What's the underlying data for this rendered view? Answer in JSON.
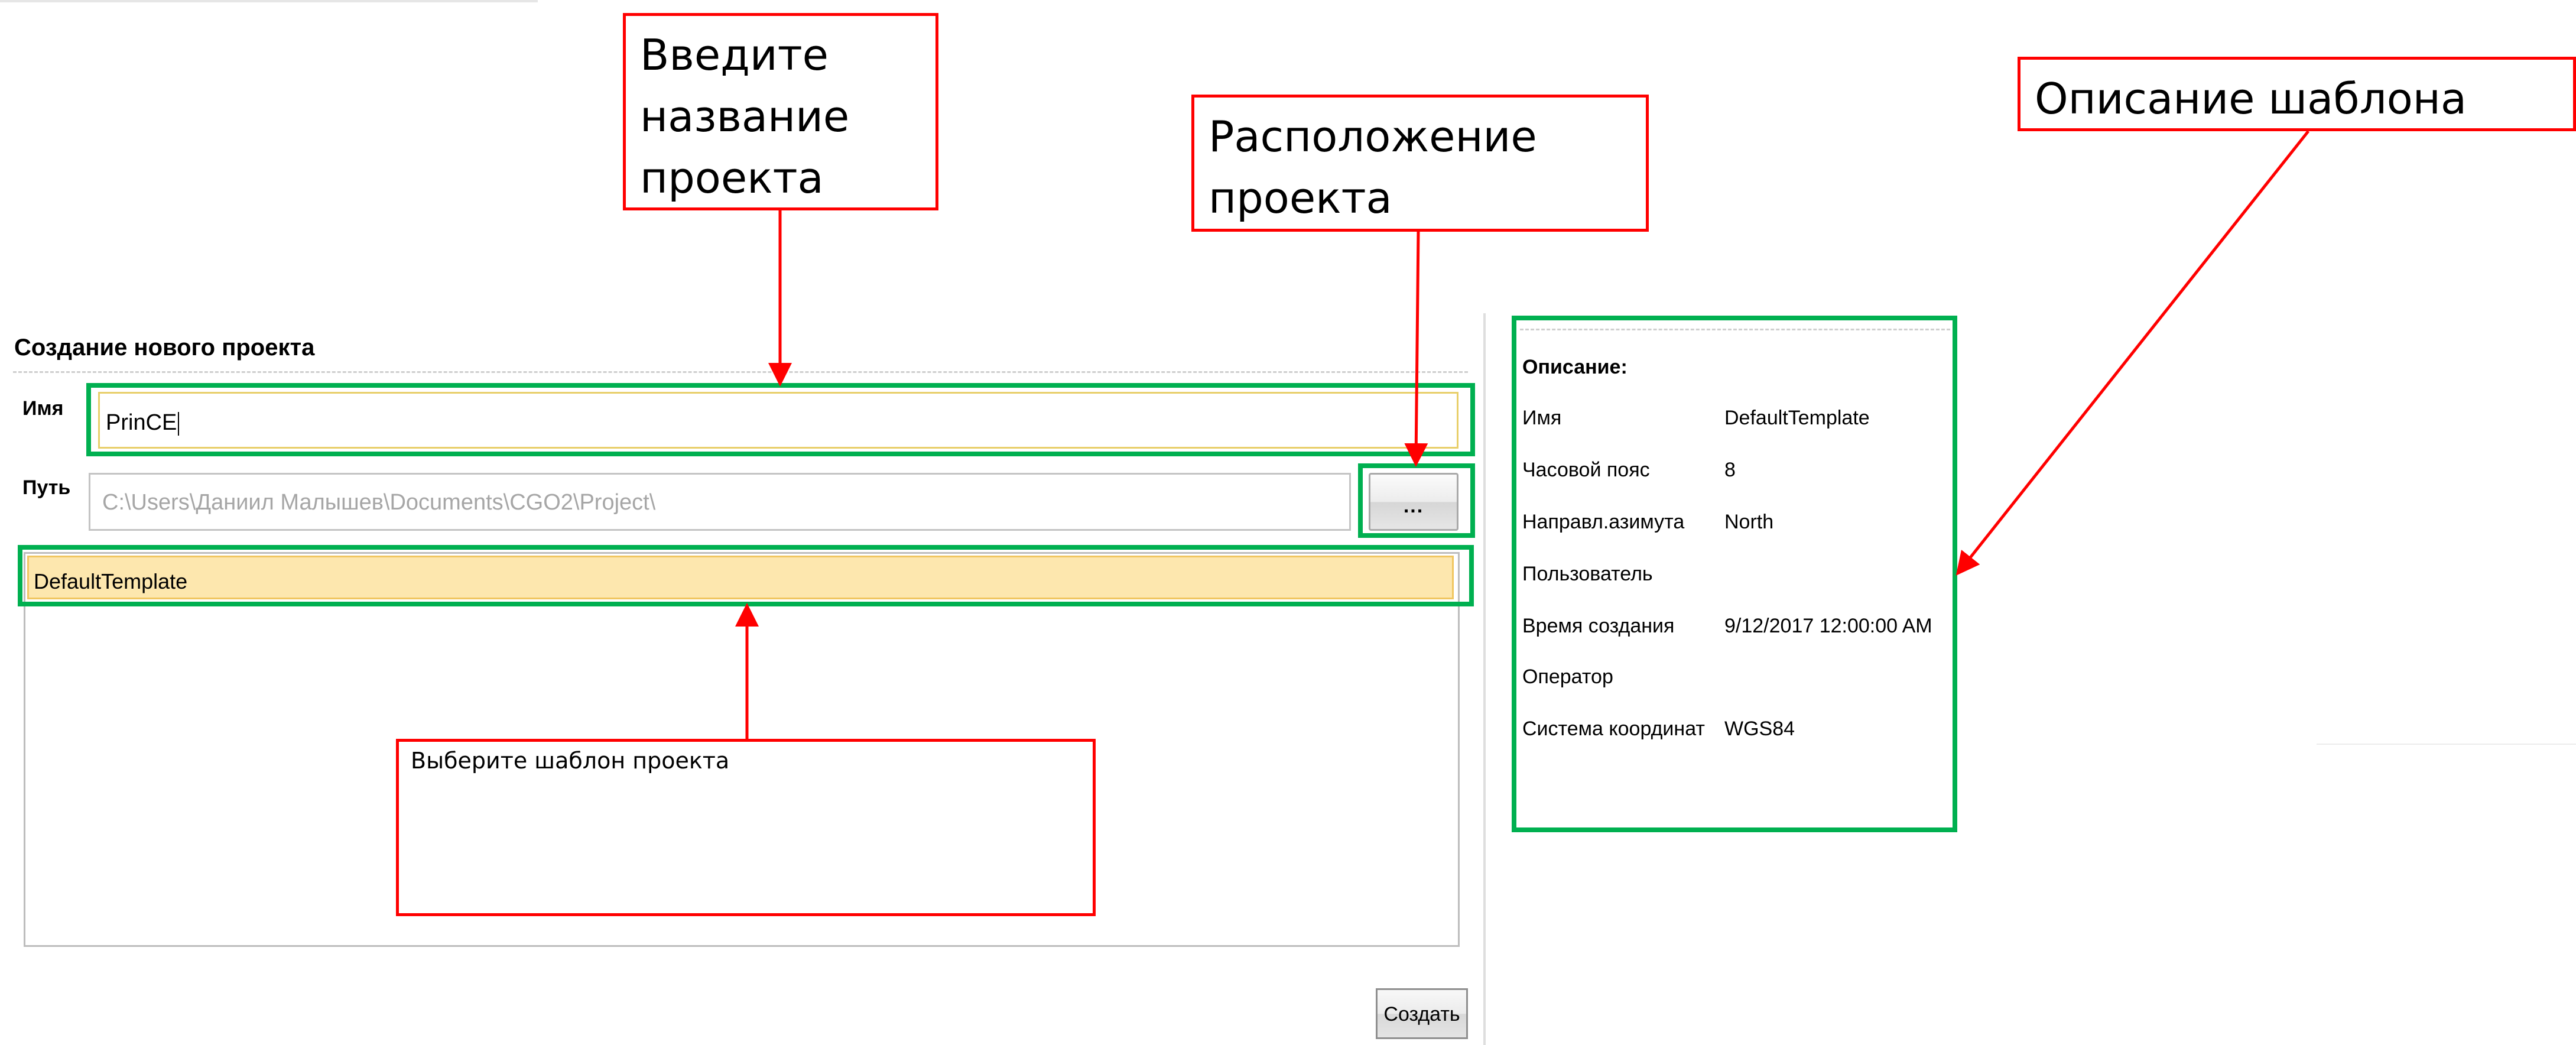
{
  "dialog": {
    "title": "Создание нового проекта",
    "name_label": "Имя",
    "name_value": "PrinCE",
    "path_label": "Путь",
    "path_value": "C:\\Users\\Даниил Малышев\\Documents\\CGO2\\Project\\",
    "browse_label": "...",
    "templates": [
      "DefaultTemplate"
    ],
    "selected_template": "DefaultTemplate",
    "create_label": "Создать"
  },
  "description": {
    "title": "Описание:",
    "rows": [
      {
        "key": "Имя",
        "value": "DefaultTemplate"
      },
      {
        "key": "Часовой пояс",
        "value": "8"
      },
      {
        "key": "Направл.азимута",
        "value": "North"
      },
      {
        "key": "Пользователь",
        "value": ""
      },
      {
        "key": "Время создания",
        "value": "9/12/2017 12:00:00 AM"
      },
      {
        "key": "Оператор",
        "value": ""
      },
      {
        "key": "Система координат",
        "value": "WGS84"
      }
    ]
  },
  "annotations": {
    "enter_name": "Введите название проекта",
    "location": "Расположение проекта",
    "template_desc": "Описание шаблона",
    "choose_template": "Выберите шаблон проекта"
  },
  "colors": {
    "highlight_green": "#00b050",
    "callout_red": "#ff0000",
    "selection_fill": "#fde7ae",
    "selection_border": "#f0c660",
    "name_focus_border": "#e8cf6a"
  }
}
